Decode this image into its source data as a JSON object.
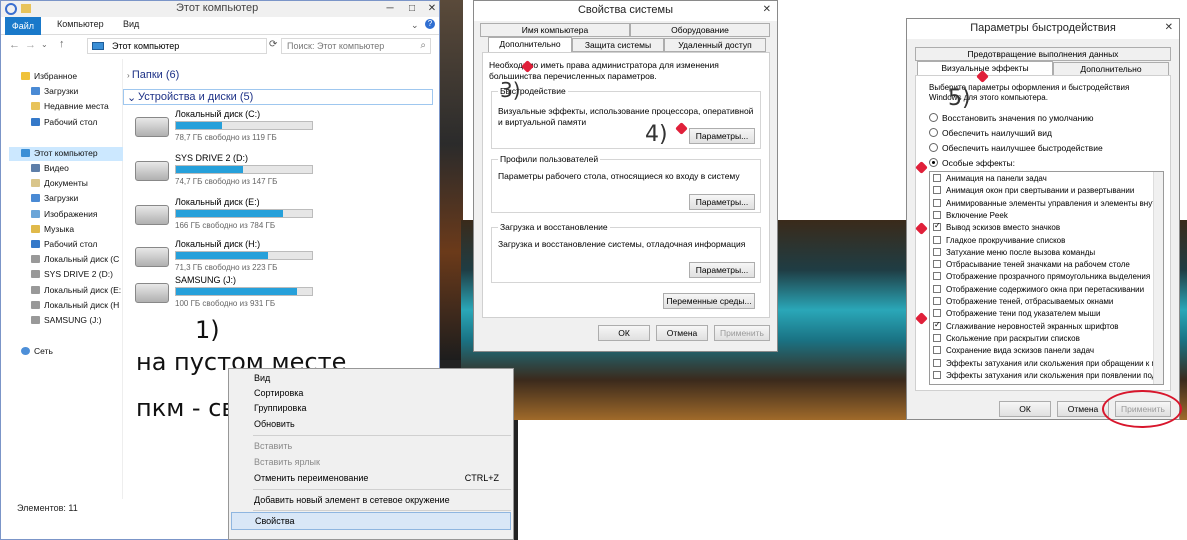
{
  "explorer": {
    "title": "Этот компьютер",
    "ribbon_tabs": [
      "Файл",
      "Компьютер",
      "Вид"
    ],
    "address": "Этот компьютер",
    "search_placeholder": "Поиск: Этот компьютер",
    "nav": {
      "favorites": "Избранное",
      "favorites_items": [
        "Загрузки",
        "Недавние места",
        "Рабочий стол"
      ],
      "this_pc": "Этот компьютер",
      "this_pc_items": [
        "Видео",
        "Документы",
        "Загрузки",
        "Изображения",
        "Музыка",
        "Рабочий стол",
        "Локальный диск (C",
        "SYS DRIVE 2 (D:)",
        "Локальный диск (E:",
        "Локальный диск (H",
        "SAMSUNG (J:)"
      ],
      "network": "Сеть"
    },
    "folders_group": "Папки (6)",
    "devices_group": "Устройства и диски (5)",
    "drives": [
      {
        "name": "Локальный диск (C:)",
        "free": "78,7 ГБ свободно из 119 ГБ",
        "used": 0.34
      },
      {
        "name": "SYS DRIVE 2 (D:)",
        "free": "74,7 ГБ свободно из 147 ГБ",
        "used": 0.49
      },
      {
        "name": "Локальный диск (E:)",
        "free": "166 ГБ свободно из 784 ГБ",
        "used": 0.79
      },
      {
        "name": "Локальный диск (H:)",
        "free": "71,3 ГБ свободно из 223 ГБ",
        "used": 0.68
      },
      {
        "name": "SAMSUNG (J:)",
        "free": "100 ГБ свободно из 931 ГБ",
        "used": 0.89
      }
    ],
    "status": "Элементов: 11"
  },
  "annotations": {
    "step1": "1)",
    "step1_text_line1": "на пустом месте",
    "step1_text_line2": "пкм - свойства",
    "step3": "3)",
    "step4": "4)",
    "step5": "5)"
  },
  "context_menu": {
    "items": [
      "Вид",
      "Сортировка",
      "Группировка",
      "Обновить",
      "Вставить",
      "Вставить ярлык",
      "Отменить переименование",
      "Добавить новый элемент в сетевое окружение",
      "Свойства"
    ],
    "shortcut": "CTRL+Z"
  },
  "system_props": {
    "title": "Свойства системы",
    "tabs_top": [
      "Имя компьютера",
      "Оборудование"
    ],
    "tabs_bottom": [
      "Дополнительно",
      "Защита системы",
      "Удаленный доступ"
    ],
    "admin_note": "Необходимо иметь права администратора для изменения большинства перечисленных параметров.",
    "perf_label": "Быстродействие",
    "perf_text": "Визуальные эффекты, использование процессора, оперативной и виртуальной памяти",
    "profiles_label": "Профили пользователей",
    "profiles_text": "Параметры рабочего стола, относящиеся ко входу в систему",
    "startup_label": "Загрузка и восстановление",
    "startup_text": "Загрузка и восстановление системы, отладочная информация",
    "params_button": "Параметры...",
    "env_button": "Переменные среды...",
    "ok": "ОК",
    "cancel": "Отмена",
    "apply": "Применить"
  },
  "perf_options": {
    "title": "Параметры быстродействия",
    "tab_top": "Предотвращение выполнения данных",
    "tabs": [
      "Визуальные эффекты",
      "Дополнительно"
    ],
    "intro": "Выберите параметры оформления и быстродействия Windows для этого компьютера.",
    "radios": [
      "Восстановить значения по умолчанию",
      "Обеспечить наилучший вид",
      "Обеспечить наилучшее быстродействие",
      "Особые эффекты:"
    ],
    "effects": [
      {
        "label": "Анимация на панели задач",
        "checked": false
      },
      {
        "label": "Анимация окон при свертывании и развертывании",
        "checked": false
      },
      {
        "label": "Анимированные элементы управления и элементы внутри",
        "checked": false
      },
      {
        "label": "Включение Peek",
        "checked": false
      },
      {
        "label": "Вывод эскизов вместо значков",
        "checked": true
      },
      {
        "label": "Гладкое прокручивание списков",
        "checked": false
      },
      {
        "label": "Затухание меню после вызова команды",
        "checked": false
      },
      {
        "label": "Отбрасывание теней значками на рабочем столе",
        "checked": false
      },
      {
        "label": "Отображение прозрачного прямоугольника выделения",
        "checked": false
      },
      {
        "label": "Отображение содержимого окна при перетаскивании",
        "checked": false
      },
      {
        "label": "Отображение теней, отбрасываемых окнами",
        "checked": false
      },
      {
        "label": "Отображение тени под указателем мыши",
        "checked": false
      },
      {
        "label": "Сглаживание неровностей экранных шрифтов",
        "checked": true
      },
      {
        "label": "Скольжение при раскрытии списков",
        "checked": false
      },
      {
        "label": "Сохранение вида эскизов панели задач",
        "checked": false
      },
      {
        "label": "Эффекты затухания или скольжения при обращении к ме",
        "checked": false
      },
      {
        "label": "Эффекты затухания или скольжения при появлении подс",
        "checked": false
      }
    ],
    "ok": "ОК",
    "cancel": "Отмена",
    "apply": "Применить"
  }
}
